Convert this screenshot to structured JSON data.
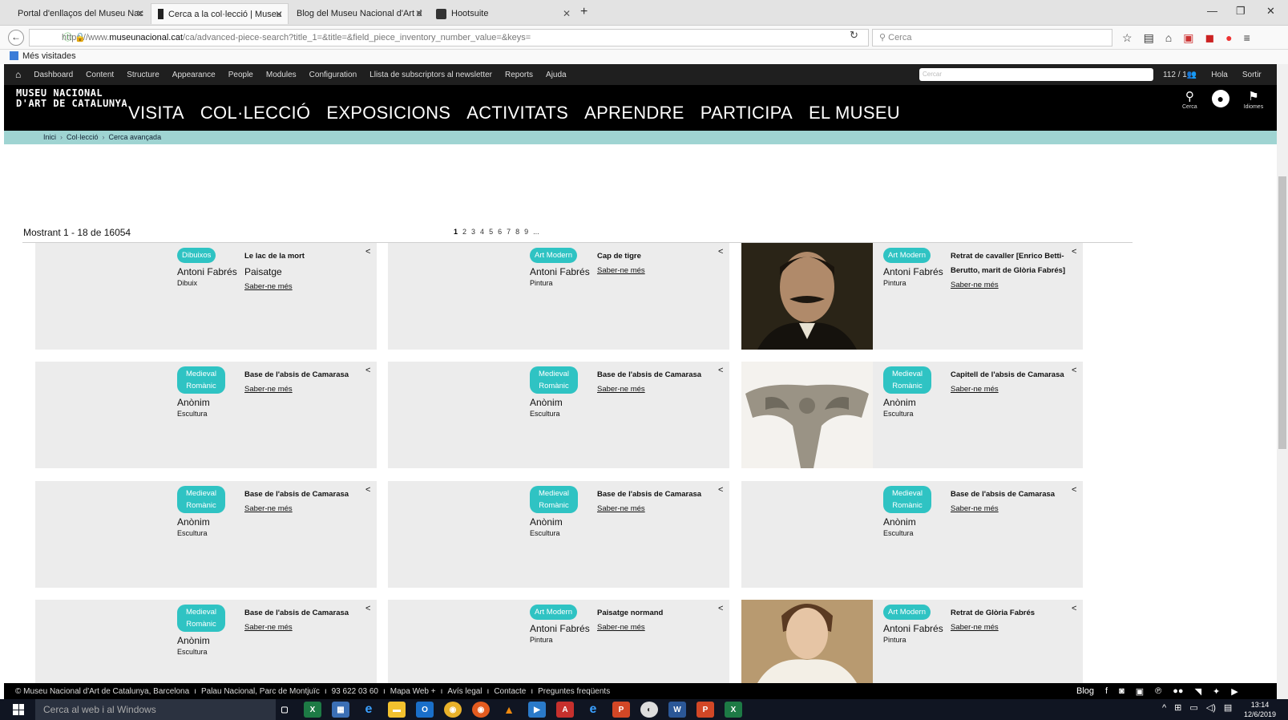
{
  "browser": {
    "tabs": [
      {
        "label": "Portal d'enllaços del Museu Nac",
        "active": false
      },
      {
        "label": "Cerca a la col·lecció | Museu",
        "active": true
      },
      {
        "label": "Blog del Museu Nacional d'Art d",
        "active": false
      },
      {
        "label": "Hootsuite",
        "active": false
      }
    ],
    "url_prefix": "https://www.",
    "url_domain": "museunacional.cat",
    "url_rest": "/ca/advanced-piece-search?title_1=&title=&field_piece_inventory_number_value=&keys=",
    "search_placeholder": "Cerca",
    "bookmarks_label": "Més visitades"
  },
  "admin": {
    "items": [
      "Dashboard",
      "Content",
      "Structure",
      "Appearance",
      "People",
      "Modules",
      "Configuration",
      "Llista de subscriptors al newsletter",
      "Reports",
      "Ajuda"
    ],
    "search_placeholder": "Cercar",
    "counter": "112 / 1",
    "hello": "Hola",
    "logout": "Sortir"
  },
  "site": {
    "logo_line1": "MUSEU NACIONAL",
    "logo_line2": "D'ART DE CATALUNYA",
    "nav": [
      "VISITA",
      "COL·LECCIÓ",
      "EXPOSICIONS",
      "ACTIVITATS",
      "APRENDRE",
      "PARTICIPA",
      "EL MUSEU"
    ],
    "search_label": "Cerca",
    "lang_label": "Idiomes"
  },
  "breadcrumb": [
    "Inici",
    "Col·lecció",
    "Cerca avançada"
  ],
  "results": {
    "showing": "Mostrant 1 - 18 de 16054",
    "pages": [
      "1",
      "2",
      "3",
      "4",
      "5",
      "6",
      "7",
      "8",
      "9",
      "..."
    ]
  },
  "cards": [
    {
      "badge": "Dibuixos",
      "artist": "Antoni Fabrés",
      "medium": "Dibuix",
      "title": "Le lac de la mort",
      "subtitle": "Paisatge",
      "more": "Saber-ne més",
      "image": "none"
    },
    {
      "badge": "Art Modern",
      "artist": "Antoni Fabrés",
      "medium": "Pintura",
      "title": "Cap de tigre",
      "subtitle": "",
      "more": "Saber-ne més",
      "image": "none"
    },
    {
      "badge": "Art Modern",
      "artist": "Antoni Fabrés",
      "medium": "Pintura",
      "title": "Retrat de cavaller [Enrico Betti-Berutto, marit de Glòria Fabrés]",
      "subtitle": "",
      "more": "Saber-ne més",
      "image": "portrait-man"
    },
    {
      "badge": "Medieval Romànic",
      "artist": "Anònim",
      "medium": "Escultura",
      "title": "Base de l'absis de Camarasa",
      "subtitle": "",
      "more": "Saber-ne més",
      "image": "none"
    },
    {
      "badge": "Medieval Romànic",
      "artist": "Anònim",
      "medium": "Escultura",
      "title": "Base de l'absis de Camarasa",
      "subtitle": "",
      "more": "Saber-ne més",
      "image": "none"
    },
    {
      "badge": "Medieval Romànic",
      "artist": "Anònim",
      "medium": "Escultura",
      "title": "Capitell de l'absis de Camarasa",
      "subtitle": "",
      "more": "Saber-ne més",
      "image": "capital"
    },
    {
      "badge": "Medieval Romànic",
      "artist": "Anònim",
      "medium": "Escultura",
      "title": "Base de l'absis de Camarasa",
      "subtitle": "",
      "more": "Saber-ne més",
      "image": "none"
    },
    {
      "badge": "Medieval Romànic",
      "artist": "Anònim",
      "medium": "Escultura",
      "title": "Base de l'absis de Camarasa",
      "subtitle": "",
      "more": "Saber-ne més",
      "image": "none"
    },
    {
      "badge": "Medieval Romànic",
      "artist": "Anònim",
      "medium": "Escultura",
      "title": "Base de l'absis de Camarasa",
      "subtitle": "",
      "more": "Saber-ne més",
      "image": "none"
    },
    {
      "badge": "Medieval Romànic",
      "artist": "Anònim",
      "medium": "Escultura",
      "title": "Base de l'absis de Camarasa",
      "subtitle": "",
      "more": "Saber-ne més",
      "image": "none"
    },
    {
      "badge": "Art Modern",
      "artist": "Antoni Fabrés",
      "medium": "Pintura",
      "title": "Paisatge normand",
      "subtitle": "",
      "more": "Saber-ne més",
      "image": "none"
    },
    {
      "badge": "Art Modern",
      "artist": "Antoni Fabrés",
      "medium": "Pintura",
      "title": "Retrat de Glòria Fabrés",
      "subtitle": "",
      "more": "Saber-ne més",
      "image": "portrait-woman"
    }
  ],
  "footer": {
    "items": [
      "© Museu Nacional d'Art de Catalunya, Barcelona",
      "Palau Nacional, Parc de Montjuïc",
      "93 622 03 60",
      "Mapa Web +",
      "Avís legal",
      "Contacte",
      "Preguntes freqüents"
    ],
    "blog": "Blog"
  },
  "taskbar": {
    "search_placeholder": "Cerca al web i al Windows",
    "time": "13:14",
    "date": "12/6/2019"
  },
  "colors": {
    "accent": "#2fc3c3",
    "breadcrumb_bg": "#9fd4d2",
    "header_bg": "#000000",
    "card_bg": "#ececec"
  }
}
